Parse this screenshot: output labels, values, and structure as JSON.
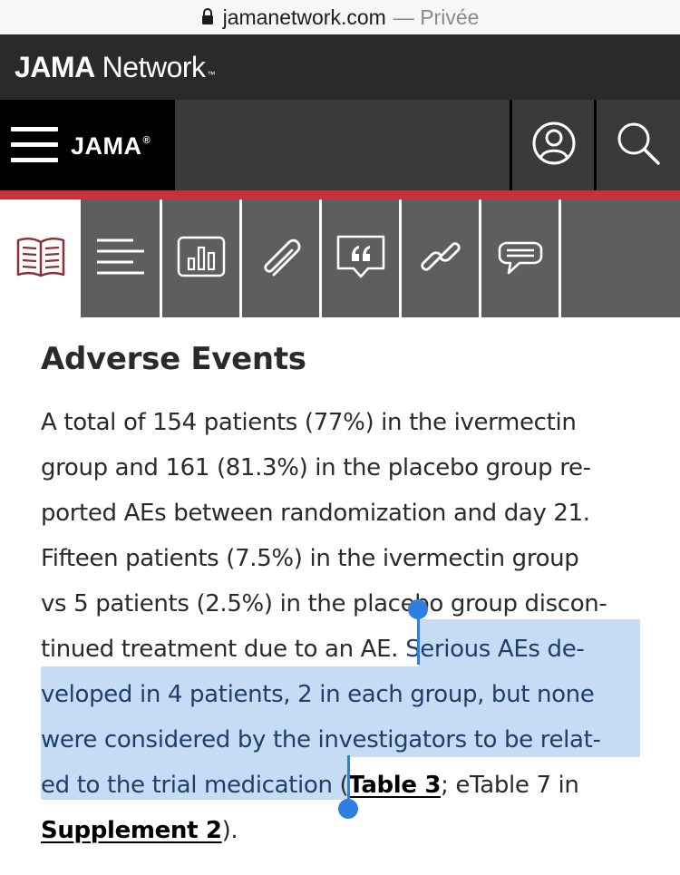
{
  "browser": {
    "domain": "jamanetwork.com",
    "mode": "— Privée",
    "icons": [
      "lock-icon"
    ]
  },
  "network_bar": {
    "brand_bold": "JAMA",
    "brand_light": "Network",
    "trademark": "™"
  },
  "header": {
    "logo": "JAMA",
    "registered": "®",
    "icons": [
      "hamburger-menu-icon",
      "account-icon",
      "search-icon"
    ]
  },
  "toolbar": {
    "tabs": [
      {
        "icon": "article-book-icon",
        "active": true
      },
      {
        "icon": "sections-list-icon",
        "active": false
      },
      {
        "icon": "figures-chart-icon",
        "active": false
      },
      {
        "icon": "attachments-paperclip-icon",
        "active": false
      },
      {
        "icon": "cite-quote-icon",
        "active": false
      },
      {
        "icon": "related-link-icon",
        "active": false
      },
      {
        "icon": "comments-icon",
        "active": false
      }
    ]
  },
  "article": {
    "heading": "Adverse Events",
    "lines": [
      "A total of 154 patients (77%) in the ivermectin",
      "group and 161 (81.3%) in the placebo group re-",
      "ported AEs between randomization and day 21.",
      "Fifteen patients (7.5%) in the ivermectin group",
      "vs 5 patients (2.5%) in the placebo group discon-",
      "tinued treatment due to an AE."
    ],
    "selected_start": "Serious AEs de-",
    "selected_lines": [
      "veloped in 4 patients, 2 in each group, but none",
      "were considered by the investigators to be relat-"
    ],
    "selected_end": "ed to the trial medication",
    "open_paren": " (",
    "link_table": "Table 3",
    "etable_text": "; eTable 7 in",
    "link_supplement": "Supplement 2",
    "closing": ")."
  },
  "colors": {
    "selection": "#c6dcf4",
    "selection_handle": "#2f7ee0",
    "accent_red": "#c8313b"
  }
}
